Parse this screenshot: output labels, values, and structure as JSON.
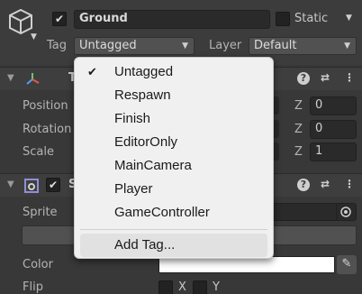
{
  "header": {
    "active": true,
    "name": "Ground",
    "static_label": "Static",
    "tag_label": "Tag",
    "tag_value": "Untagged",
    "layer_label": "Layer",
    "layer_value": "Default"
  },
  "transform": {
    "title": "T",
    "rows": [
      {
        "label": "Position",
        "z_label": "Z",
        "z": "0"
      },
      {
        "label": "Rotation",
        "z_label": "Z",
        "z": "0"
      },
      {
        "label": "Scale",
        "z_label": "Z",
        "z": "1"
      }
    ]
  },
  "sprite_renderer": {
    "title": "S",
    "enabled": true,
    "sprite_label": "Sprite",
    "color_label": "Color",
    "flip_label": "Flip",
    "flip_x": "X",
    "flip_y": "Y"
  },
  "tag_menu": {
    "items": [
      {
        "label": "Untagged",
        "checked": true
      },
      {
        "label": "Respawn"
      },
      {
        "label": "Finish"
      },
      {
        "label": "EditorOnly"
      },
      {
        "label": "MainCamera"
      },
      {
        "label": "Player"
      },
      {
        "label": "GameController"
      }
    ],
    "add_tag_label": "Add Tag..."
  },
  "colors": {
    "bg": "#383838",
    "menu_bg": "#f0f0f0",
    "field_bg": "#2a2a2a"
  }
}
